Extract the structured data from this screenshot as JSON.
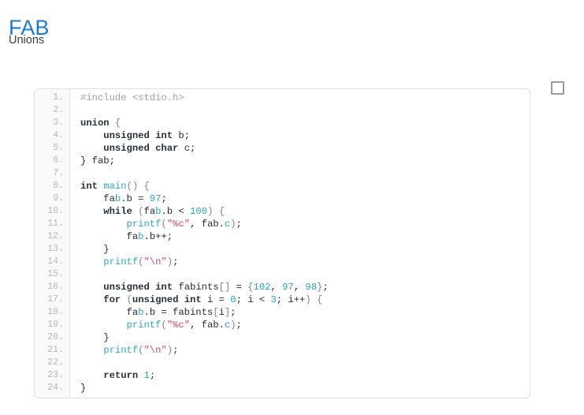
{
  "header": {
    "title": "FAB",
    "subtitle": "Unions",
    "title_color": "#1a7ae0",
    "subtitle_color": "#3c4043"
  },
  "checkbox": {
    "checked": false,
    "label": ""
  },
  "code_block": {
    "language": "c",
    "line_numbers": [
      "1.",
      "2.",
      "3.",
      "4.",
      "5.",
      "6.",
      "7.",
      "8.",
      "9.",
      "10.",
      "11.",
      "12.",
      "13.",
      "14.",
      "15.",
      "16.",
      "17.",
      "18.",
      "19.",
      "20.",
      "21.",
      "22.",
      "23.",
      "24."
    ],
    "lines": [
      "#include <stdio.h>",
      "",
      "union {",
      "    unsigned int b;",
      "    unsigned char c;",
      "} fab;",
      "",
      "int main() {",
      "    fab.b = 97;",
      "    while (fab.b < 100) {",
      "        printf(\"%c\", fab.c);",
      "        fab.b++;",
      "    }",
      "    printf(\"\\n\");",
      "",
      "    unsigned int fabints[] = {102, 97, 98};",
      "    for (unsigned int i = 0; i < 3; i++) {",
      "        fab.b = fabints[i];",
      "        printf(\"%c\", fab.c);",
      "    }",
      "    printf(\"\\n\");",
      "",
      "    return 1;",
      "}"
    ],
    "tokens": [
      [
        [
          "#include <stdio.h>",
          "t-pre"
        ]
      ],
      [],
      [
        [
          "union",
          "t-kw"
        ],
        [
          " ",
          "t-plain"
        ],
        [
          "{",
          "t-punc"
        ]
      ],
      [
        [
          "    ",
          "t-plain"
        ],
        [
          "unsigned",
          "t-kw"
        ],
        [
          " ",
          "t-plain"
        ],
        [
          "int",
          "t-kw"
        ],
        [
          " b;",
          "t-plain"
        ]
      ],
      [
        [
          "    ",
          "t-plain"
        ],
        [
          "unsigned",
          "t-kw"
        ],
        [
          " ",
          "t-plain"
        ],
        [
          "char",
          "t-kw"
        ],
        [
          " c;",
          "t-plain"
        ]
      ],
      [
        [
          "} fab;",
          "t-plain"
        ]
      ],
      [],
      [
        [
          "int",
          "t-kw"
        ],
        [
          " ",
          "t-plain"
        ],
        [
          "main",
          "t-fn"
        ],
        [
          "()",
          "t-punc"
        ],
        [
          " ",
          "t-plain"
        ],
        [
          "{",
          "t-punc"
        ]
      ],
      [
        [
          "    fa",
          "t-plain"
        ],
        [
          "b",
          "t-var"
        ],
        [
          ".b = ",
          "t-plain"
        ],
        [
          "97",
          "t-num"
        ],
        [
          ";",
          "t-plain"
        ]
      ],
      [
        [
          "    ",
          "t-plain"
        ],
        [
          "while",
          "t-kw"
        ],
        [
          " ",
          "t-plain"
        ],
        [
          "(",
          "t-punc"
        ],
        [
          "fa",
          "t-plain"
        ],
        [
          "b",
          "t-var"
        ],
        [
          ".b ",
          "t-plain"
        ],
        [
          "<",
          "t-plain"
        ],
        [
          " ",
          "t-plain"
        ],
        [
          "100",
          "t-num"
        ],
        [
          ")",
          "t-punc"
        ],
        [
          " ",
          "t-plain"
        ],
        [
          "{",
          "t-punc"
        ]
      ],
      [
        [
          "        ",
          "t-plain"
        ],
        [
          "printf",
          "t-fn"
        ],
        [
          "(",
          "t-punc"
        ],
        [
          "\"%c\"",
          "t-str"
        ],
        [
          ", fab.",
          "t-plain"
        ],
        [
          "c",
          "t-var"
        ],
        [
          ")",
          "t-punc"
        ],
        [
          ";",
          "t-plain"
        ]
      ],
      [
        [
          "        fa",
          "t-plain"
        ],
        [
          "b",
          "t-var"
        ],
        [
          ".b++;",
          "t-plain"
        ]
      ],
      [
        [
          "    }",
          "t-plain"
        ]
      ],
      [
        [
          "    ",
          "t-plain"
        ],
        [
          "printf",
          "t-fn"
        ],
        [
          "(",
          "t-punc"
        ],
        [
          "\"\\n\"",
          "t-str"
        ],
        [
          ")",
          "t-punc"
        ],
        [
          ";",
          "t-plain"
        ]
      ],
      [],
      [
        [
          "    ",
          "t-plain"
        ],
        [
          "unsigned",
          "t-kw"
        ],
        [
          " ",
          "t-plain"
        ],
        [
          "int",
          "t-kw"
        ],
        [
          " fabints",
          "t-plain"
        ],
        [
          "[]",
          "t-punc"
        ],
        [
          " = ",
          "t-plain"
        ],
        [
          "{",
          "t-punc"
        ],
        [
          "102",
          "t-num"
        ],
        [
          ", ",
          "t-plain"
        ],
        [
          "97",
          "t-num"
        ],
        [
          ", ",
          "t-plain"
        ],
        [
          "98",
          "t-num"
        ],
        [
          "}",
          "t-punc"
        ],
        [
          ";",
          "t-plain"
        ]
      ],
      [
        [
          "    ",
          "t-plain"
        ],
        [
          "for",
          "t-kw"
        ],
        [
          " ",
          "t-plain"
        ],
        [
          "(",
          "t-punc"
        ],
        [
          "unsigned",
          "t-kw"
        ],
        [
          " ",
          "t-plain"
        ],
        [
          "int",
          "t-kw"
        ],
        [
          " i = ",
          "t-plain"
        ],
        [
          "0",
          "t-num"
        ],
        [
          "; i < ",
          "t-plain"
        ],
        [
          "3",
          "t-num"
        ],
        [
          "; i++",
          "t-plain"
        ],
        [
          ")",
          "t-punc"
        ],
        [
          " ",
          "t-plain"
        ],
        [
          "{",
          "t-punc"
        ]
      ],
      [
        [
          "        fa",
          "t-plain"
        ],
        [
          "b",
          "t-var"
        ],
        [
          ".b = fabints",
          "t-plain"
        ],
        [
          "[",
          "t-punc"
        ],
        [
          "i",
          "t-plain"
        ],
        [
          "]",
          "t-punc"
        ],
        [
          ";",
          "t-plain"
        ]
      ],
      [
        [
          "        ",
          "t-plain"
        ],
        [
          "printf",
          "t-fn"
        ],
        [
          "(",
          "t-punc"
        ],
        [
          "\"%c\"",
          "t-str"
        ],
        [
          ", fab.",
          "t-plain"
        ],
        [
          "c",
          "t-var"
        ],
        [
          ")",
          "t-punc"
        ],
        [
          ";",
          "t-plain"
        ]
      ],
      [
        [
          "    }",
          "t-plain"
        ]
      ],
      [
        [
          "    ",
          "t-plain"
        ],
        [
          "printf",
          "t-fn"
        ],
        [
          "(",
          "t-punc"
        ],
        [
          "\"\\n\"",
          "t-str"
        ],
        [
          ")",
          "t-punc"
        ],
        [
          ";",
          "t-plain"
        ]
      ],
      [],
      [
        [
          "    ",
          "t-plain"
        ],
        [
          "return",
          "t-kw"
        ],
        [
          " ",
          "t-plain"
        ],
        [
          "1",
          "t-num"
        ],
        [
          ";",
          "t-plain"
        ]
      ],
      [
        [
          "}",
          "t-plain"
        ]
      ]
    ]
  },
  "colors": {
    "accent": "#1a7ae0",
    "keyword": "#23303e",
    "function": "#2aa9c4",
    "number": "#1fa8b8",
    "string": "#e0436c",
    "preprocessor": "#a0a0a0",
    "gutter_text": "#b7b7bd",
    "gutter_bg": "#fafafb",
    "block_border": "#dfdfdf"
  }
}
